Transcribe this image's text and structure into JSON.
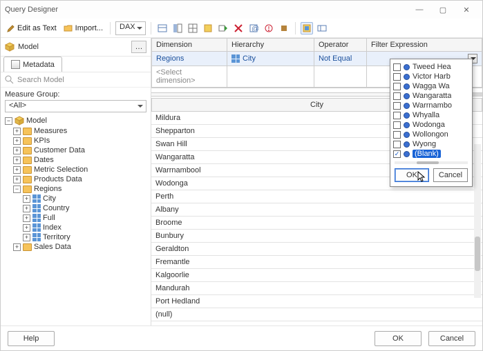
{
  "window": {
    "title": "Query Designer"
  },
  "toolbar": {
    "edit_as_text": "Edit as Text",
    "import": "Import...",
    "language": "DAX"
  },
  "left": {
    "model_label": "Model",
    "metadata_tab": "Metadata",
    "search_placeholder": "Search Model",
    "measure_group_label": "Measure Group:",
    "measure_group_value": "<All>",
    "tree": {
      "root": "Model",
      "measures": "Measures",
      "kpis": "KPIs",
      "customer_data": "Customer Data",
      "dates": "Dates",
      "metric_selection": "Metric Selection",
      "products_data": "Products Data",
      "regions": "Regions",
      "city": "City",
      "country": "Country",
      "full": "Full",
      "index": "Index",
      "territory": "Territory",
      "sales_data": "Sales Data"
    }
  },
  "filter": {
    "headers": {
      "dimension": "Dimension",
      "hierarchy": "Hierarchy",
      "operator": "Operator",
      "expr": "Filter Expression"
    },
    "row": {
      "dimension": "Regions",
      "hierarchy": "City",
      "operator": "Not Equal"
    },
    "select_dimension": "<Select dimension>"
  },
  "results": {
    "header": "City",
    "rows": [
      "Mildura",
      "Shepparton",
      "Swan Hill",
      "Wangaratta",
      "Warrnambool",
      "Wodonga",
      "Perth",
      "Albany",
      "Broome",
      "Bunbury",
      "Geraldton",
      "Fremantle",
      "Kalgoorlie",
      "Mandurah",
      "Port Hedland",
      "(null)"
    ]
  },
  "popup": {
    "items": [
      {
        "label": "Tweed Hea",
        "checked": false
      },
      {
        "label": "Victor Harb",
        "checked": false
      },
      {
        "label": "Wagga Wa",
        "checked": false
      },
      {
        "label": "Wangaratta",
        "checked": false
      },
      {
        "label": "Warrnambo",
        "checked": false
      },
      {
        "label": "Whyalla",
        "checked": false
      },
      {
        "label": "Wodonga",
        "checked": false
      },
      {
        "label": "Wollongon",
        "checked": false
      },
      {
        "label": "Wyong",
        "checked": false
      },
      {
        "label": "(Blank)",
        "checked": true,
        "selected": true
      }
    ],
    "ok": "OK",
    "cancel": "Cancel"
  },
  "footer": {
    "help": "Help",
    "ok": "OK",
    "cancel": "Cancel"
  }
}
